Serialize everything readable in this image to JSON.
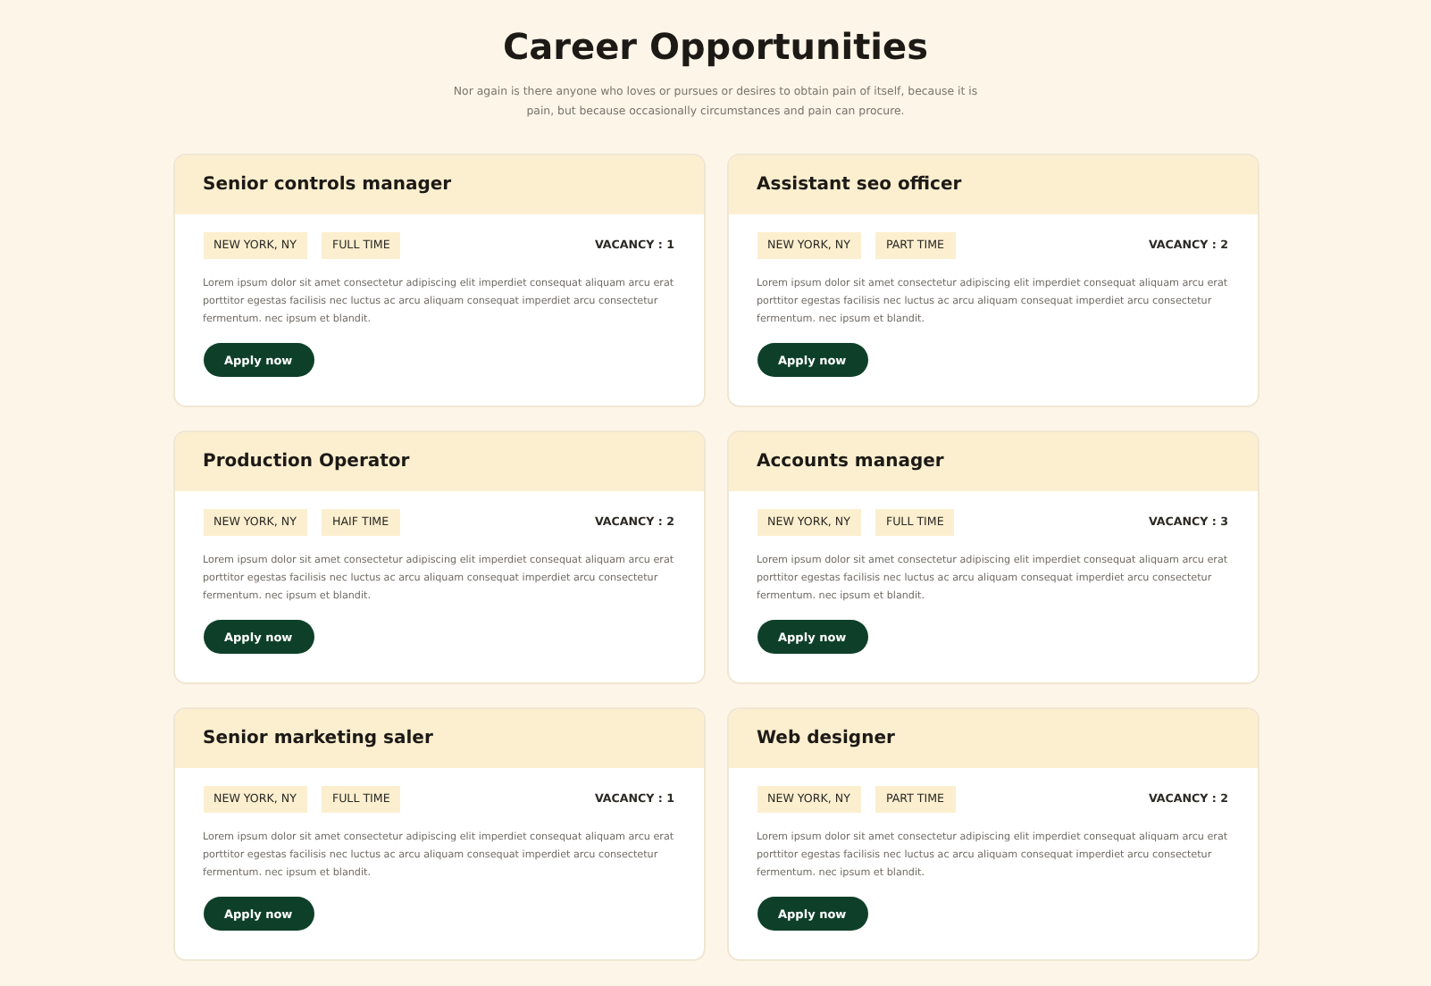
{
  "title": "Career Opportunities",
  "subtitle": "Nor again is there anyone who loves or pursues or desires to obtain pain of itself, because it is pain, but because occasionally circumstances and pain can procure.",
  "jobs": [
    {
      "title": "Senior controls manager",
      "tags": [
        "NEW YORK, NY",
        "FULL TIME"
      ],
      "vacancy": "VACANCY : 1",
      "description": "Lorem ipsum dolor sit amet consectetur adipiscing elit imperdiet consequat aliquam arcu erat porttitor egestas facilisis nec luctus ac arcu aliquam consequat imperdiet arcu consectetur fermentum. nec ipsum et blandit.",
      "button": "Apply now"
    },
    {
      "title": "Assistant seo officer",
      "tags": [
        "NEW YORK, NY",
        "PART TIME"
      ],
      "vacancy": "VACANCY : 2",
      "description": "Lorem ipsum dolor sit amet consectetur adipiscing elit imperdiet consequat aliquam arcu erat porttitor egestas facilisis nec luctus ac arcu aliquam consequat imperdiet arcu consectetur fermentum. nec ipsum et blandit.",
      "button": "Apply now"
    },
    {
      "title": "Production Operator",
      "tags": [
        "NEW YORK, NY",
        "HAIF TIME"
      ],
      "vacancy": "VACANCY : 2",
      "description": "Lorem ipsum dolor sit amet consectetur adipiscing elit imperdiet consequat aliquam arcu erat porttitor egestas facilisis nec luctus ac arcu aliquam consequat imperdiet arcu consectetur fermentum. nec ipsum et blandit.",
      "button": "Apply now"
    },
    {
      "title": "Accounts manager",
      "tags": [
        "NEW YORK, NY",
        "FULL TIME"
      ],
      "vacancy": "VACANCY : 3",
      "description": "Lorem ipsum dolor sit amet consectetur adipiscing elit imperdiet consequat aliquam arcu erat porttitor egestas facilisis nec luctus ac arcu aliquam consequat imperdiet arcu consectetur fermentum. nec ipsum et blandit.",
      "button": "Apply now"
    },
    {
      "title": "Senior marketing saler",
      "tags": [
        "NEW YORK, NY",
        "FULL TIME"
      ],
      "vacancy": "VACANCY : 1",
      "description": "Lorem ipsum dolor sit amet consectetur adipiscing elit imperdiet consequat aliquam arcu erat porttitor egestas facilisis nec luctus ac arcu aliquam consequat imperdiet arcu consectetur fermentum. nec ipsum et blandit.",
      "button": "Apply now"
    },
    {
      "title": "Web designer",
      "tags": [
        "NEW YORK, NY",
        "PART TIME"
      ],
      "vacancy": "VACANCY : 2",
      "description": "Lorem ipsum dolor sit amet consectetur adipiscing elit imperdiet consequat aliquam arcu erat porttitor egestas facilisis nec luctus ac arcu aliquam consequat imperdiet arcu consectetur fermentum. nec ipsum et blandit.",
      "button": "Apply now"
    }
  ]
}
